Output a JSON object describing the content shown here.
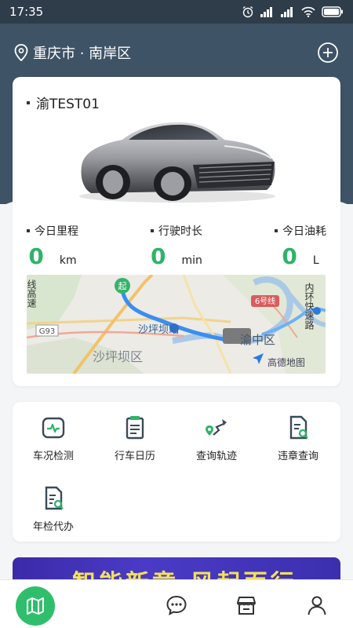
{
  "status_bar": {
    "time": "17:35"
  },
  "location": {
    "text": "重庆市 · 南岸区",
    "icon": "location-pin-icon"
  },
  "vehicle": {
    "plate": "渝TEST01"
  },
  "stats": [
    {
      "label": "今日里程",
      "value": "0",
      "unit": "km"
    },
    {
      "label": "行驶时长",
      "value": "0",
      "unit": "min"
    },
    {
      "label": "今日油耗",
      "value": "0",
      "unit": "L"
    }
  ],
  "map": {
    "labels": {
      "g93": "G93",
      "shapingba_station": "沙坪坝站",
      "shapingba_district": "沙坪坝区",
      "yuzhong": "渝中区",
      "line6": "6号线",
      "amap": "高德地图",
      "neihuan": "内环快速路",
      "highway_left": "线高速",
      "start_marker": "起"
    }
  },
  "functions": [
    {
      "label": "车况检测",
      "icon": "vehicle-check-icon"
    },
    {
      "label": "行车日历",
      "icon": "calendar-icon"
    },
    {
      "label": "查询轨迹",
      "icon": "track-icon"
    },
    {
      "label": "违章查询",
      "icon": "violation-icon"
    },
    {
      "label": "年检代办",
      "icon": "inspection-icon"
    }
  ],
  "banner": {
    "text": "智能新章 风起而行"
  },
  "colors": {
    "accent": "#2fb36a",
    "header": "#3f5366",
    "nav_active": "#2fbf6c"
  }
}
